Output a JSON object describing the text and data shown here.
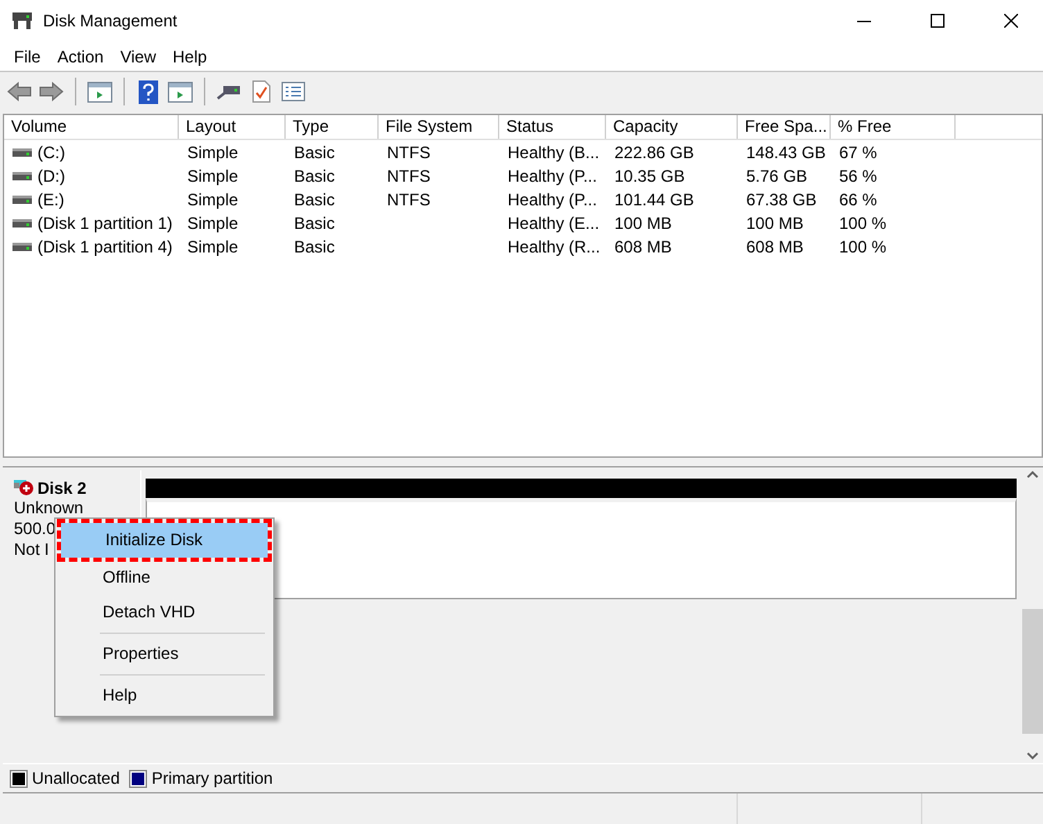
{
  "window": {
    "title": "Disk Management"
  },
  "menu": [
    "File",
    "Action",
    "View",
    "Help"
  ],
  "volume_table": {
    "columns": [
      "Volume",
      "Layout",
      "Type",
      "File System",
      "Status",
      "Capacity",
      "Free Spa...",
      "% Free"
    ],
    "rows": [
      [
        "(C:)",
        "Simple",
        "Basic",
        "NTFS",
        "Healthy (B...",
        "222.86 GB",
        "148.43 GB",
        "67 %"
      ],
      [
        "(D:)",
        "Simple",
        "Basic",
        "NTFS",
        "Healthy (P...",
        "10.35 GB",
        "5.76 GB",
        "56 %"
      ],
      [
        "(E:)",
        "Simple",
        "Basic",
        "NTFS",
        "Healthy (P...",
        "101.44 GB",
        "67.38 GB",
        "66 %"
      ],
      [
        "(Disk 1 partition 1)",
        "Simple",
        "Basic",
        "",
        "Healthy (E...",
        "100 MB",
        "100 MB",
        "100 %"
      ],
      [
        "(Disk 1 partition 4)",
        "Simple",
        "Basic",
        "",
        "Healthy (R...",
        "608 MB",
        "608 MB",
        "100 %"
      ]
    ]
  },
  "disk": {
    "name": "Disk 2",
    "lines": [
      "Unknown",
      "500.0",
      "Not I"
    ]
  },
  "context_menu": [
    {
      "label": "Initialize Disk",
      "selected": true,
      "outlined": true,
      "separator_before": false
    },
    {
      "label": "Offline",
      "selected": false,
      "outlined": false,
      "separator_before": false
    },
    {
      "label": "Detach VHD",
      "selected": false,
      "outlined": false,
      "separator_before": false
    },
    {
      "label": "Properties",
      "selected": false,
      "outlined": false,
      "separator_before": true
    },
    {
      "label": "Help",
      "selected": false,
      "outlined": false,
      "separator_before": true
    }
  ],
  "legend": [
    {
      "label": "Unallocated",
      "color": "#000000"
    },
    {
      "label": "Primary partition",
      "color": "#000080"
    }
  ]
}
